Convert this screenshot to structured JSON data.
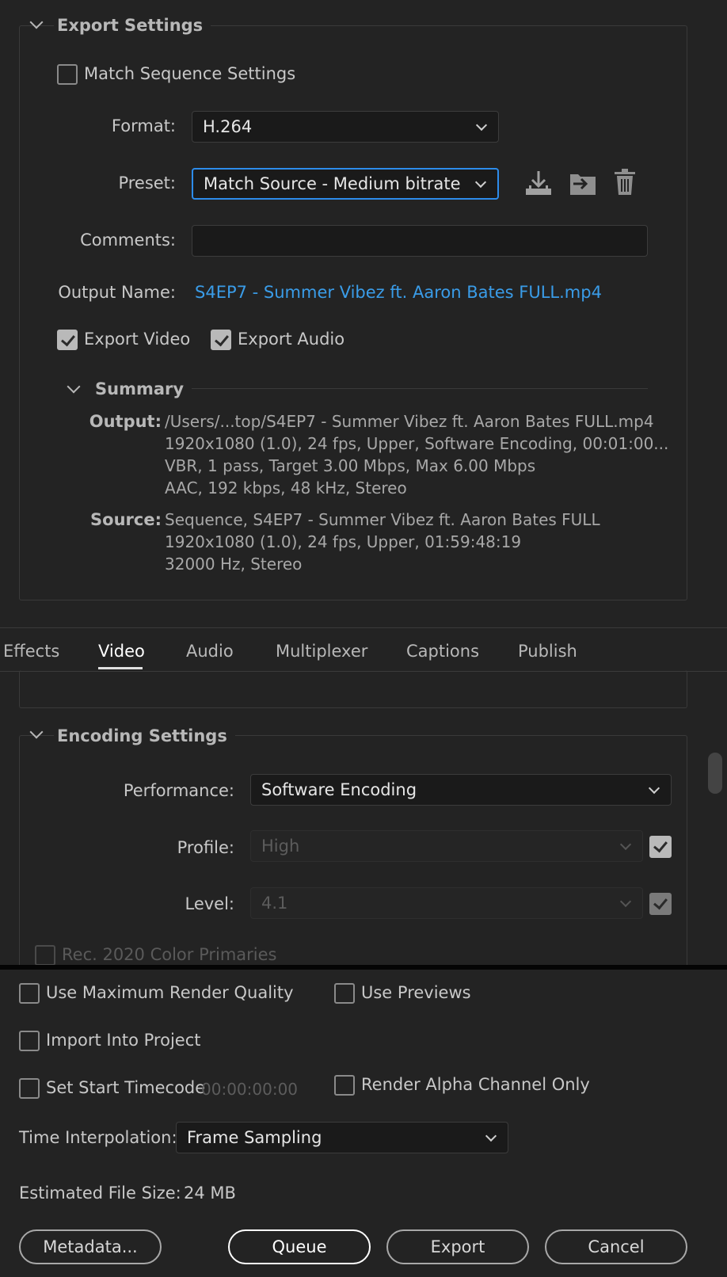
{
  "export_settings": {
    "title": "Export Settings",
    "match_sequence_label": "Match Sequence Settings",
    "format_label": "Format:",
    "format_value": "H.264",
    "preset_label": "Preset:",
    "preset_value": "Match Source - Medium bitrate",
    "comments_label": "Comments:",
    "comments_value": "",
    "output_name_label": "Output Name:",
    "output_name_value": "S4EP7 - Summer Vibez ft. Aaron Bates FULL.mp4",
    "export_video_label": "Export Video",
    "export_audio_label": "Export Audio",
    "icons": [
      "save-preset-icon",
      "import-preset-icon",
      "delete-preset-icon"
    ]
  },
  "summary": {
    "title": "Summary",
    "output_key": "Output:",
    "output_lines": [
      "/Users/...top/S4EP7 - Summer Vibez ft. Aaron Bates FULL.mp4",
      "1920x1080 (1.0), 24 fps, Upper, Software Encoding, 00:01:00...",
      "VBR, 1 pass, Target 3.00 Mbps, Max 6.00 Mbps",
      "AAC, 192 kbps, 48 kHz, Stereo"
    ],
    "source_key": "Source:",
    "source_lines": [
      "Sequence, S4EP7 - Summer Vibez ft. Aaron Bates FULL",
      "1920x1080 (1.0), 24 fps, Upper, 01:59:48:19",
      "32000 Hz, Stereo"
    ]
  },
  "tabs": [
    "Effects",
    "Video",
    "Audio",
    "Multiplexer",
    "Captions",
    "Publish"
  ],
  "active_tab": "Video",
  "encoding": {
    "title": "Encoding Settings",
    "performance_label": "Performance:",
    "performance_value": "Software Encoding",
    "profile_label": "Profile:",
    "profile_value": "High",
    "level_label": "Level:",
    "level_value": "4.1",
    "rec2020_label": "Rec. 2020 Color Primaries"
  },
  "bottom": {
    "max_render_label": "Use Maximum Render Quality",
    "use_previews_label": "Use Previews",
    "import_project_label": "Import Into Project",
    "start_timecode_label": "Set Start Timecode",
    "start_timecode_value": "00:00:00:00",
    "alpha_label": "Render Alpha Channel Only",
    "time_interp_label": "Time Interpolation:",
    "time_interp_value": "Frame Sampling",
    "file_size_label": "Estimated File Size:",
    "file_size_value": "24 MB"
  },
  "buttons": {
    "metadata": "Metadata...",
    "queue": "Queue",
    "export": "Export",
    "cancel": "Cancel"
  },
  "colors": {
    "accent": "#2d8ceb",
    "link": "#3a9ce8",
    "background": "#232323"
  }
}
